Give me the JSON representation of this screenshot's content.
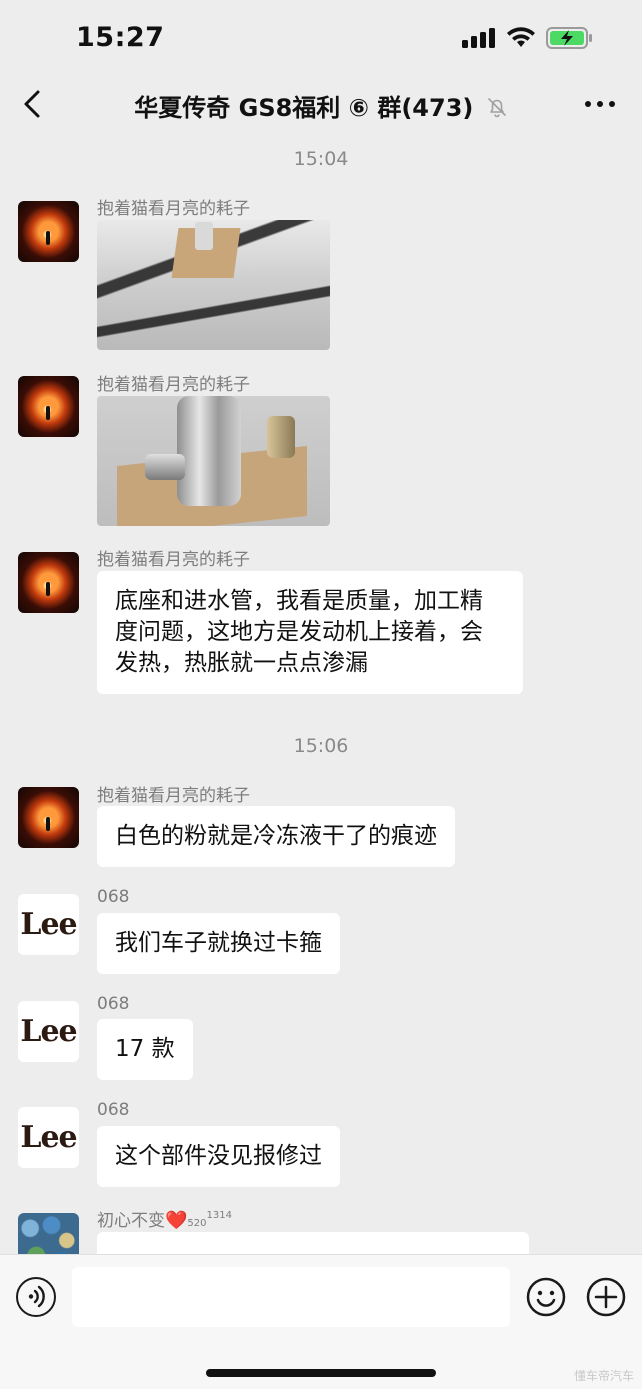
{
  "status_bar": {
    "time": "15:27",
    "icons": [
      "signal-icon",
      "wifi-icon",
      "battery-charging-icon"
    ],
    "battery_color": "#4cd964"
  },
  "nav": {
    "title": "华夏传奇 GS8福利 ⑥ 群(473)",
    "back_icon": "chevron-left-icon",
    "mute_icon": "bell-slash-icon",
    "more_icon": "more-dots-icon"
  },
  "messages": {
    "time1": "15:04",
    "time2": "15:06",
    "m1": {
      "sender": "抱着猫看月亮的耗子",
      "type": "image"
    },
    "m2": {
      "sender": "抱着猫看月亮的耗子",
      "type": "image"
    },
    "m3": {
      "sender": "抱着猫看月亮的耗子",
      "text": "底座和进水管，我看是质量，加工精度问题，这地方是发动机上接着，会发热，热胀就一点点渗漏"
    },
    "m4": {
      "sender": "抱着猫看月亮的耗子",
      "text": "白色的粉就是冷冻液干了的痕迹"
    },
    "m5": {
      "sender": "068",
      "text": "我们车子就换过卡箍",
      "avatar_text": "Lee"
    },
    "m6": {
      "sender": "068",
      "text": "17 款",
      "avatar_text": "Lee"
    },
    "m7": {
      "sender": "068",
      "text": "这个部件没见报修过",
      "avatar_text": "Lee"
    },
    "m8": {
      "sender": "初心不变",
      "sender_heart": "❤️",
      "sender_sub": "520",
      "sender_sup": "1314",
      "text": ""
    }
  },
  "input_bar": {
    "voice_icon": "voice-icon",
    "emoji_icon": "emoji-icon",
    "plus_icon": "plus-circle-icon",
    "input_value": ""
  },
  "watermark": "懂车帝汽车",
  "colors": {
    "background": "#ededed",
    "bubble": "#ffffff",
    "input_bar": "#f7f7f7"
  }
}
